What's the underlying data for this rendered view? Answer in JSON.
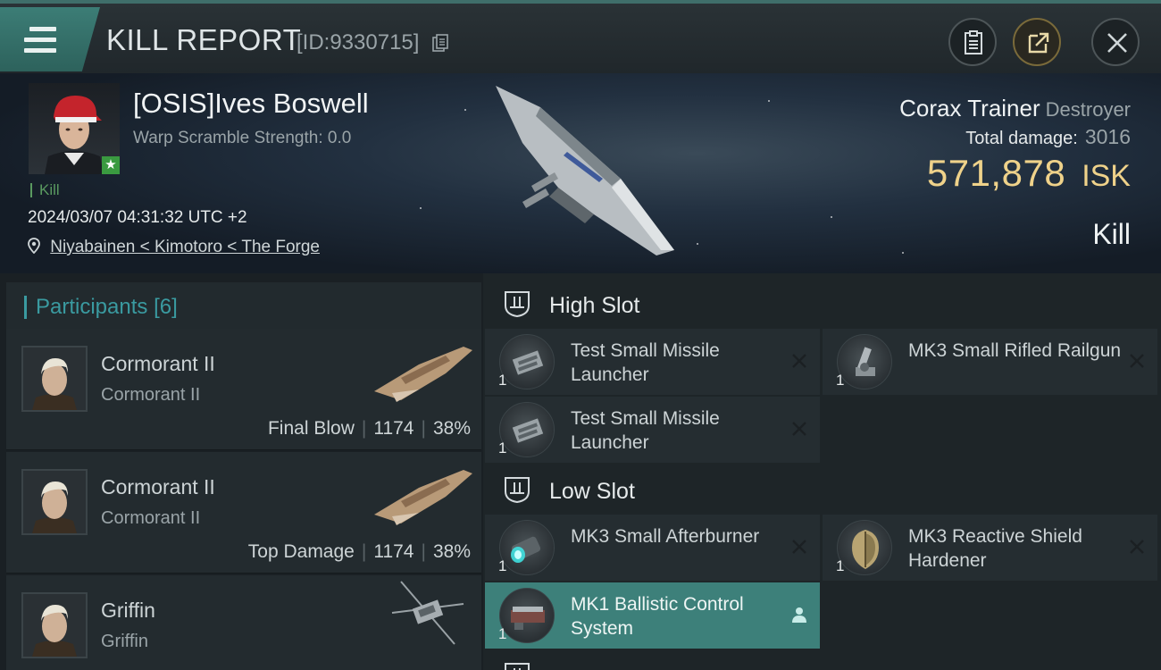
{
  "header": {
    "title": "KILL REPORT",
    "report_id": "[ID:9330715]"
  },
  "victim": {
    "name": "[OSIS]Ives Boswell",
    "warp_scramble": "Warp Scramble Strength: 0.0",
    "kill_tag": "Kill",
    "datetime": "2024/03/07 04:31:32 UTC +2",
    "location": "Niyabainen < Kimotoro < The Forge",
    "ship_name": "Corax Trainer",
    "ship_class": "Destroyer",
    "total_damage_label": "Total damage:",
    "total_damage": "3016",
    "isk_value": "571,878",
    "isk_unit": "ISK",
    "result": "Kill"
  },
  "participants": {
    "title": "Participants",
    "count": "[6]",
    "items": [
      {
        "pilot_ship": "Cormorant II",
        "ship": "Cormorant II",
        "tag": "Final Blow",
        "damage": "1174",
        "percent": "38%"
      },
      {
        "pilot_ship": "Cormorant II",
        "ship": "Cormorant II",
        "tag": "Top Damage",
        "damage": "1174",
        "percent": "38%"
      },
      {
        "pilot_ship": "Griffin",
        "ship": "Griffin"
      }
    ]
  },
  "fitting": {
    "high_slot": {
      "title": "High Slot",
      "modules": [
        {
          "qty": "1",
          "name": "Test Small Missile Launcher",
          "status": "destroyed"
        },
        {
          "qty": "1",
          "name": "MK3 Small Rifled Railgun",
          "status": "destroyed"
        },
        {
          "qty": "1",
          "name": "Test Small Missile Launcher",
          "status": "destroyed"
        }
      ]
    },
    "low_slot": {
      "title": "Low Slot",
      "modules": [
        {
          "qty": "1",
          "name": "MK3 Small Afterburner",
          "status": "destroyed"
        },
        {
          "qty": "1",
          "name": "MK3 Reactive Shield Hardener",
          "status": "destroyed"
        },
        {
          "qty": "1",
          "name": "MK1 Ballistic Control System",
          "status": "dropped"
        }
      ]
    }
  },
  "colors": {
    "accent_teal": "#3d807a",
    "isk_gold": "#efd28a",
    "kill_green": "#5a9a60"
  }
}
